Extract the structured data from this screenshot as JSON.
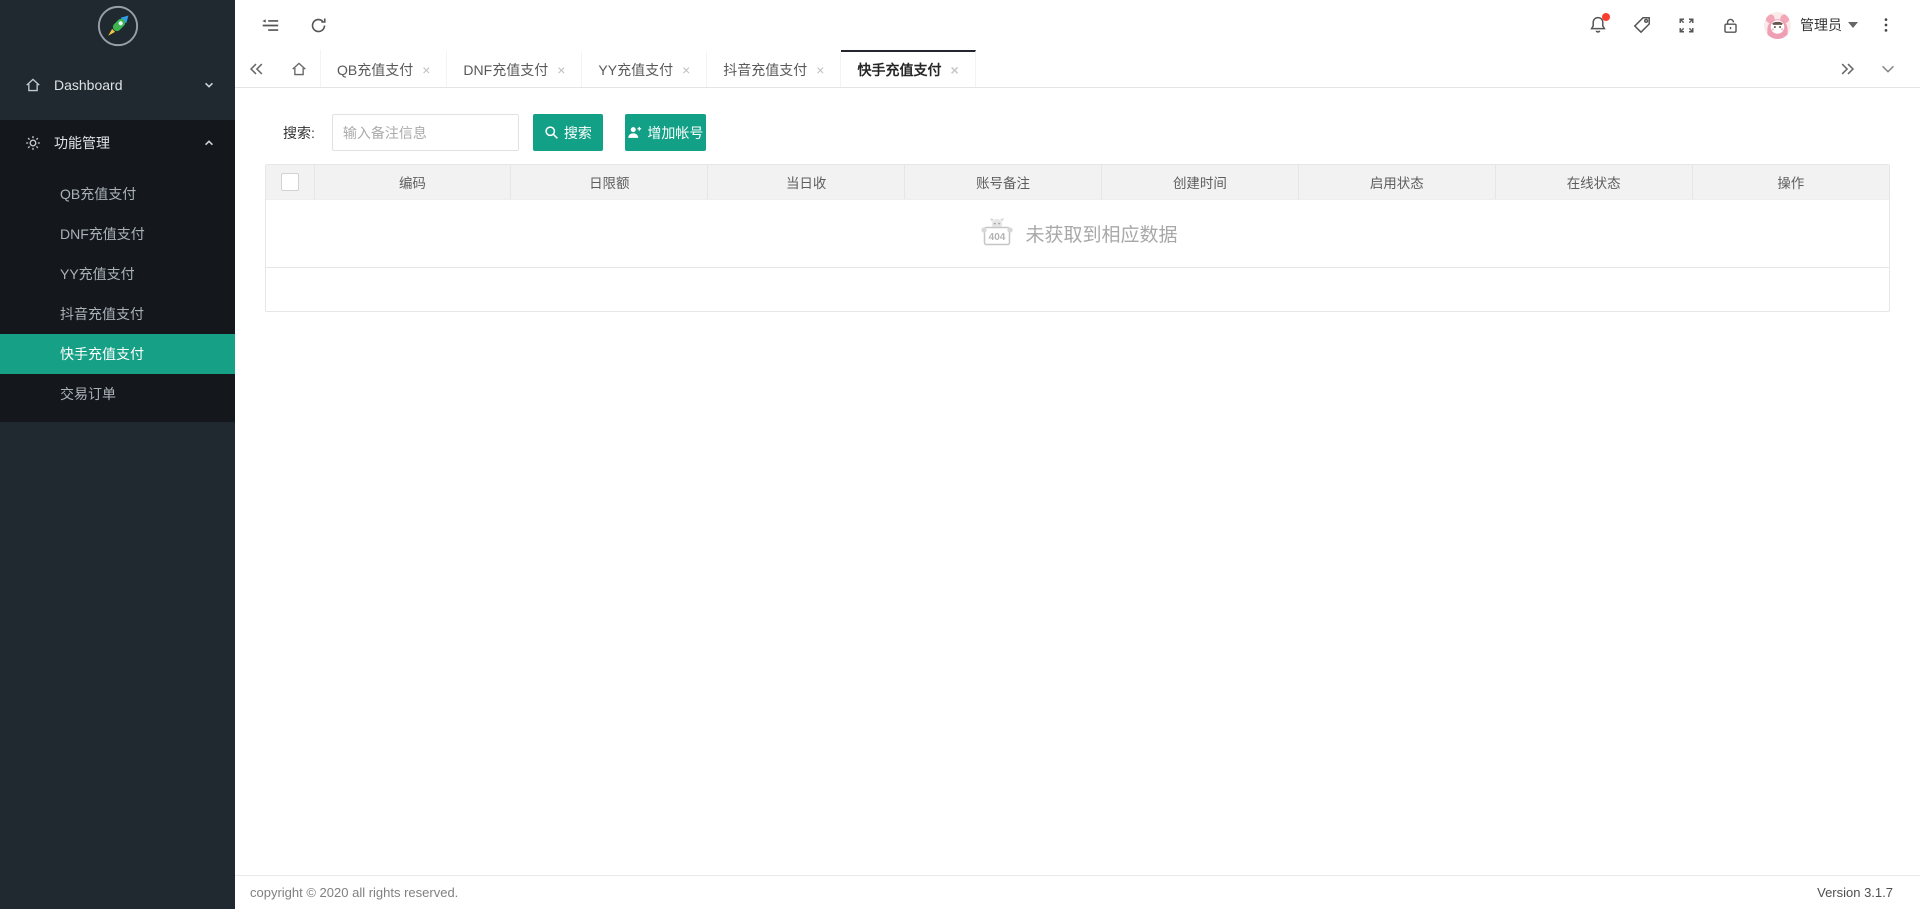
{
  "sidebar": {
    "menu": [
      {
        "label": "Dashboard"
      },
      {
        "label": "功能管理"
      }
    ],
    "submenu": [
      {
        "label": "QB充值支付"
      },
      {
        "label": "DNF充值支付"
      },
      {
        "label": "YY充值支付"
      },
      {
        "label": "抖音充值支付"
      },
      {
        "label": "快手充值支付",
        "active": true
      },
      {
        "label": "交易订单"
      }
    ]
  },
  "topbar": {
    "user_name": "管理员"
  },
  "tabbar": {
    "close_glyph": "×",
    "tabs": [
      {
        "label": "QB充值支付"
      },
      {
        "label": "DNF充值支付"
      },
      {
        "label": "YY充值支付"
      },
      {
        "label": "抖音充值支付"
      },
      {
        "label": "快手充值支付",
        "active": true
      }
    ]
  },
  "toolbar": {
    "search_label": "搜索:",
    "search_placeholder": "输入备注信息",
    "search_button_label": "搜索",
    "add_button_label": "增加帐号"
  },
  "table": {
    "headers": [
      "编码",
      "日限额",
      "当日收",
      "账号备注",
      "创建时间",
      "启用状态",
      "在线状态",
      "操作"
    ],
    "rows": [],
    "empty_text": "未获取到相应数据",
    "empty_icon_label": "404"
  },
  "footer": {
    "copyright": "copyright © 2020 all rights reserved.",
    "version": "Version 3.1.7"
  },
  "colors": {
    "accent": "#12a086",
    "sidebar_bg": "#20292f",
    "submenu_bg": "#14181d",
    "active_item_bg": "#16a085",
    "badge_dot": "#fa3d2f",
    "active_tab_border": "#23272d"
  }
}
